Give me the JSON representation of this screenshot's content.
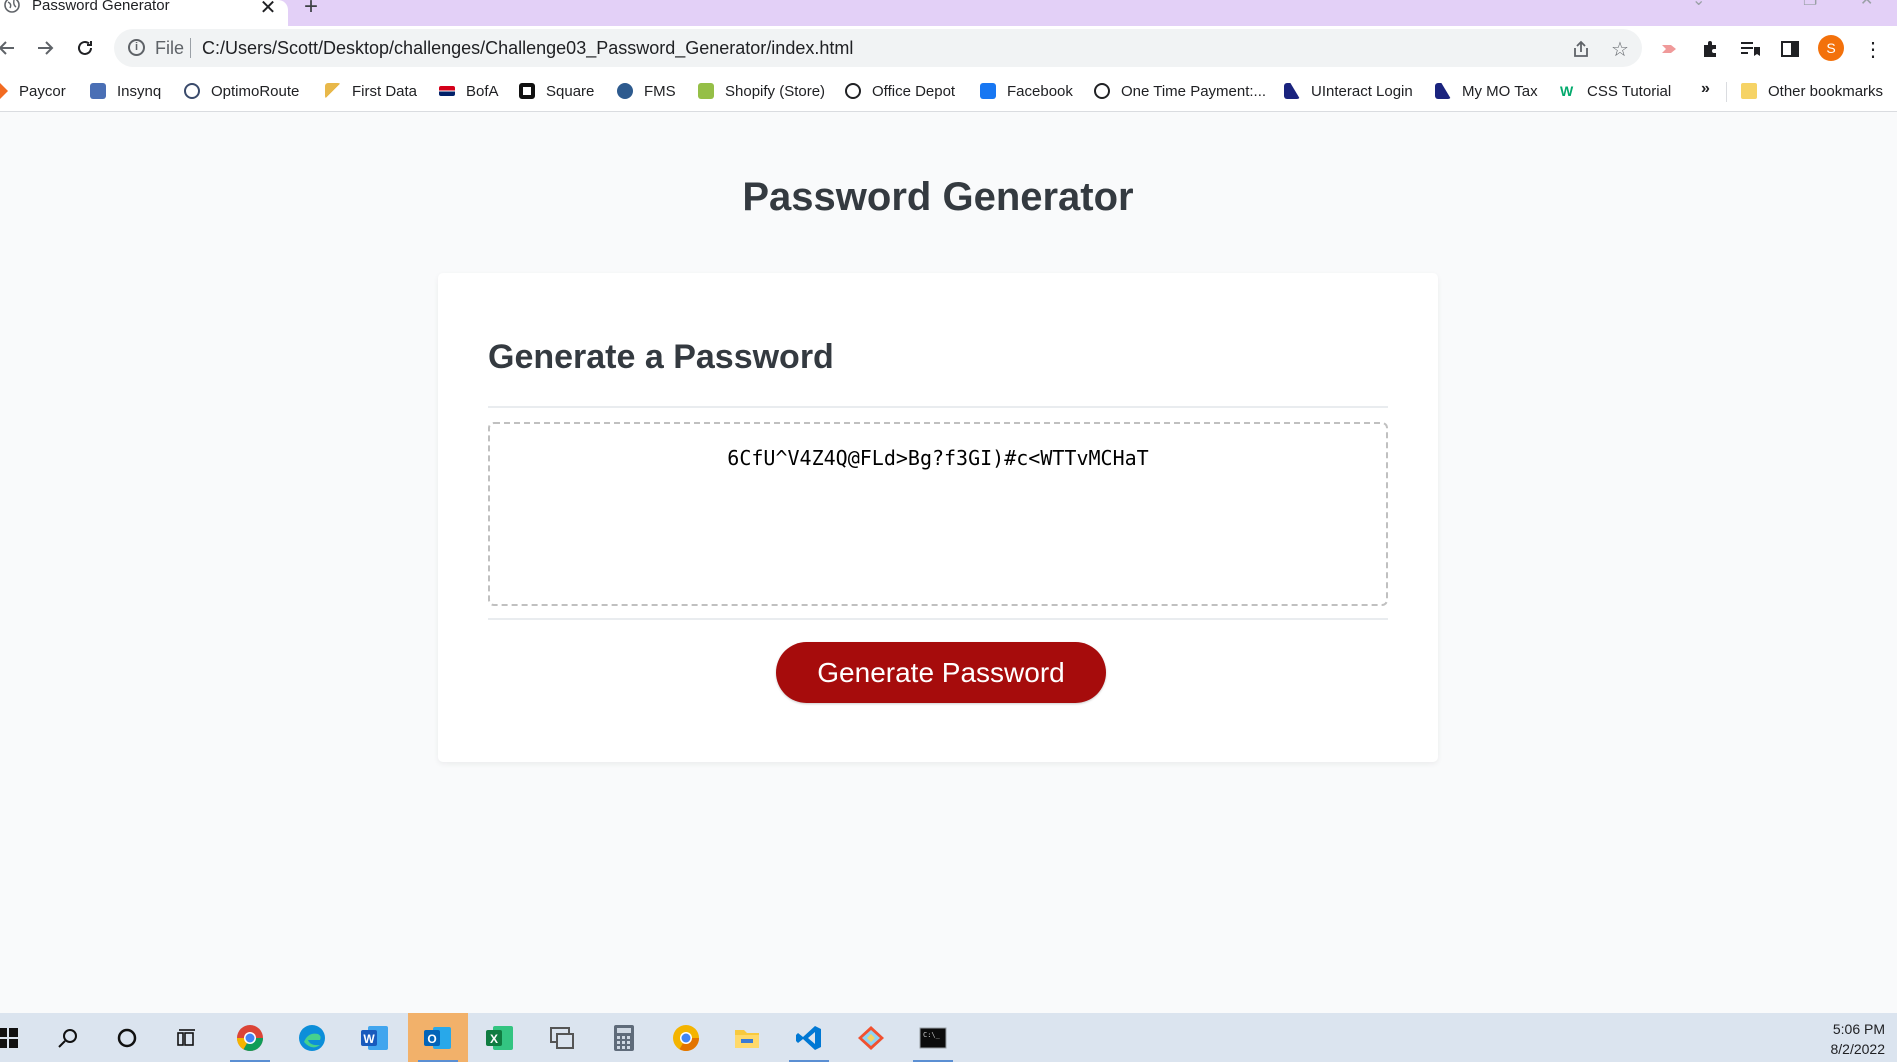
{
  "browser": {
    "tab_title": "Password Generator",
    "tab_close": "✕",
    "new_tab": "+",
    "url_scheme": "File",
    "url": "C:/Users/Scott/Desktop/challenges/Challenge03_Password_Generator/index.html",
    "avatar_letter": "S",
    "bookmarks_overflow": "»",
    "bookmarks": [
      {
        "label": "Paycor",
        "icon": "paycor-icon",
        "color": "#f26b21"
      },
      {
        "label": "Insynq",
        "icon": "insynq-icon",
        "color": "#4a6fb5"
      },
      {
        "label": "OptimoRoute",
        "icon": "optimoroute-icon",
        "color": "#3a4a6b"
      },
      {
        "label": "First Data",
        "icon": "first-data-icon",
        "color": "#e8b84a"
      },
      {
        "label": "BofA",
        "icon": "bofa-icon",
        "color": "#d4001a"
      },
      {
        "label": "Square",
        "icon": "square-icon",
        "color": "#111111"
      },
      {
        "label": "FMS",
        "icon": "fms-icon",
        "color": "#2d5a8e"
      },
      {
        "label": "Shopify (Store)",
        "icon": "shopify-icon",
        "color": "#95bf47"
      },
      {
        "label": "Office Depot",
        "icon": "globe-icon",
        "color": "#202124"
      },
      {
        "label": "Facebook",
        "icon": "facebook-icon",
        "color": "#1877f2"
      },
      {
        "label": "One Time Payment:...",
        "icon": "globe-icon",
        "color": "#202124"
      },
      {
        "label": "UInteract Login",
        "icon": "uinteract-icon",
        "color": "#1a237e"
      },
      {
        "label": "My MO Tax",
        "icon": "mo-tax-icon",
        "color": "#1a237e"
      },
      {
        "label": "CSS Tutorial",
        "icon": "w3schools-icon",
        "color": "#04aa6d"
      },
      {
        "label": "Other bookmarks",
        "icon": "folder-icon",
        "color": "#f6d365"
      }
    ]
  },
  "page": {
    "title": "Password Generator",
    "card_header": "Generate a Password",
    "password": "6CfU^V4Z4Q@FLd>Bg?f3GI)#c<WTTvMCHaT",
    "button_label": "Generate Password"
  },
  "taskbar": {
    "time": "5:06 PM",
    "date": "8/2/2022",
    "apps": [
      "start-icon",
      "search-icon",
      "cortana-icon",
      "task-view-icon",
      "chrome-icon",
      "edge-icon",
      "word-icon",
      "outlook-icon",
      "excel-icon",
      "remote-desktop-icon",
      "calculator-icon",
      "chrome-canary-icon",
      "file-explorer-icon",
      "vscode-icon",
      "git-icon",
      "terminal-icon"
    ]
  },
  "colors": {
    "button": "#a60c0c",
    "heading": "#343a40",
    "tabstrip": "#e3d0f7"
  }
}
